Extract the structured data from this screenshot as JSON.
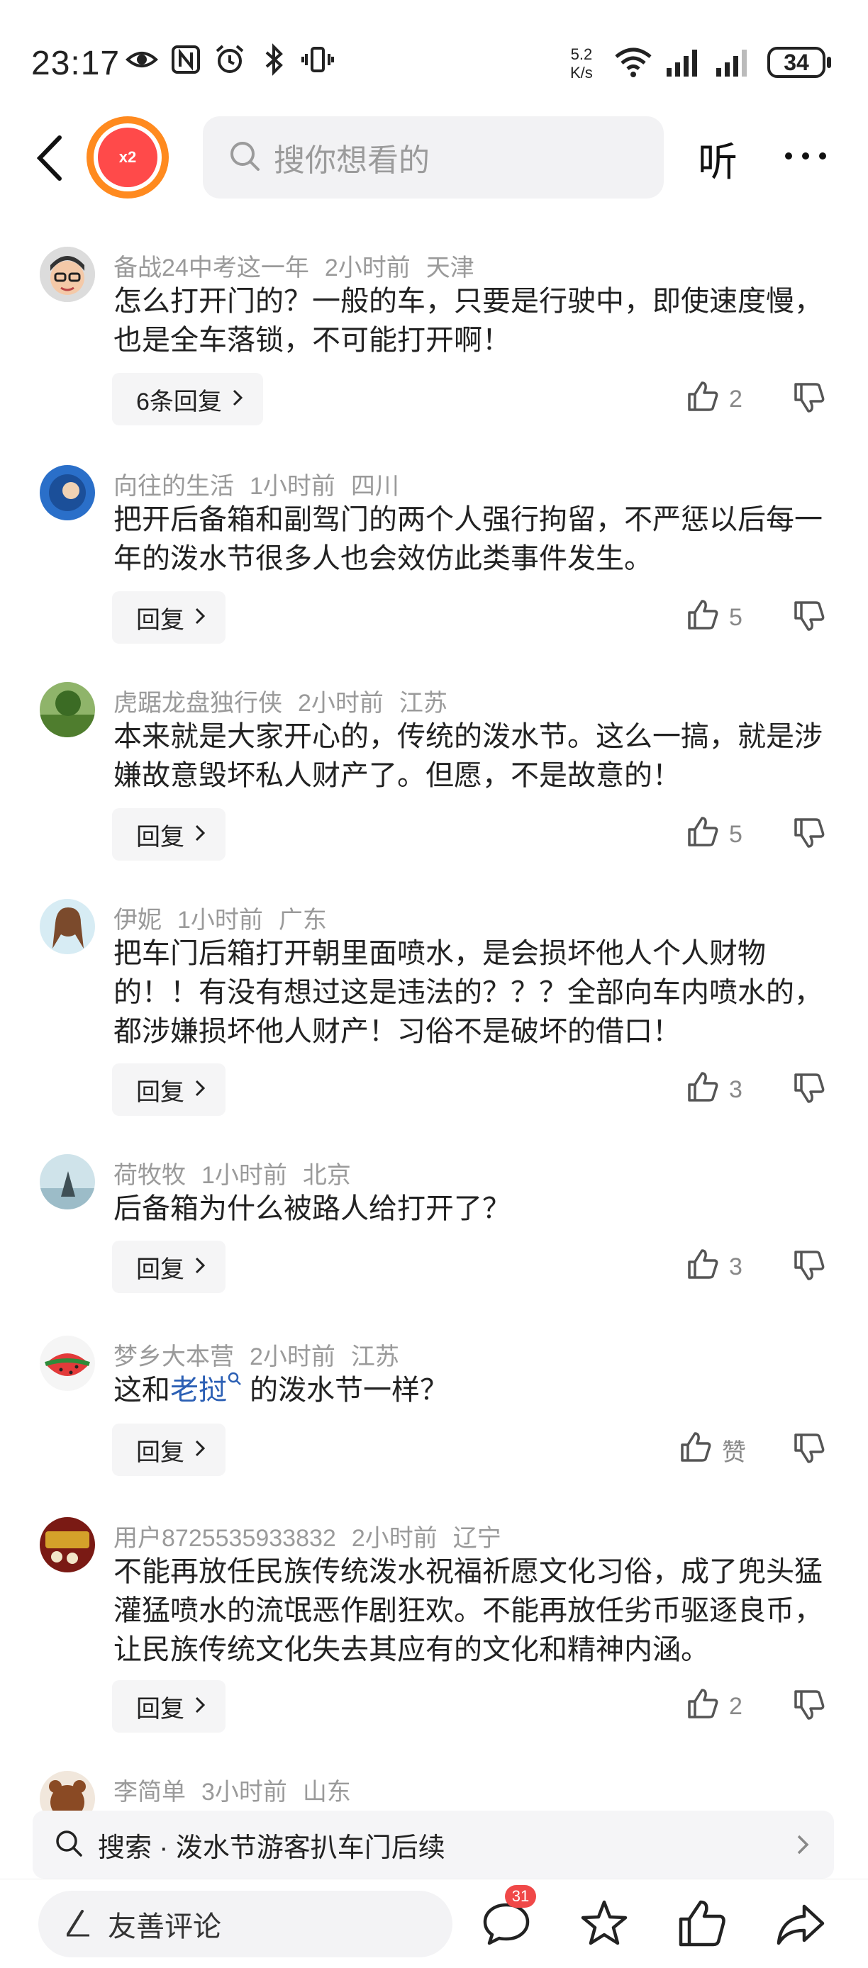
{
  "status_bar": {
    "time": "23:17",
    "net_speed_top": "5.2",
    "net_speed_unit": "K/s",
    "battery": "34"
  },
  "header": {
    "badge_text": "x2",
    "search_placeholder": "搜你想看的",
    "listen_label": "听"
  },
  "comments": [
    {
      "user": "备战24中考这一年",
      "time": "2小时前",
      "location": "天津",
      "text": "怎么打开门的？一般的车，只要是行驶中，即使速度慢，也是全车落锁，不可能打开啊！",
      "reply_label": "6条回复",
      "likes": "2"
    },
    {
      "user": "向往的生活",
      "time": "1小时前",
      "location": "四川",
      "text": "把开后备箱和副驾门的两个人强行拘留，不严惩以后每一年的泼水节很多人也会效仿此类事件发生。",
      "reply_label": "回复",
      "likes": "5"
    },
    {
      "user": "虎踞龙盘独行侠",
      "time": "2小时前",
      "location": "江苏",
      "text": "本来就是大家开心的，传统的泼水节。这么一搞，就是涉嫌故意毁坏私人财产了。但愿，不是故意的！",
      "reply_label": "回复",
      "likes": "5"
    },
    {
      "user": "伊妮",
      "time": "1小时前",
      "location": "广东",
      "text": "把车门后箱打开朝里面喷水，是会损坏他人个人财物的！！有没有想过这是违法的？？？全部向车内喷水的，都涉嫌损坏他人财产！习俗不是破坏的借口！",
      "reply_label": "回复",
      "likes": "3"
    },
    {
      "user": "荷牧牧",
      "time": "1小时前",
      "location": "北京",
      "text": "后备箱为什么被路人给打开了？",
      "reply_label": "回复",
      "likes": "3"
    },
    {
      "user": "梦乡大本营",
      "time": "2小时前",
      "location": "江苏",
      "text_before": "这和",
      "text_link": "老挝",
      "text_after": "的泼水节一样？",
      "reply_label": "回复",
      "likes": "赞"
    },
    {
      "user": "用户8725535933832",
      "time": "2小时前",
      "location": "辽宁",
      "text": "不能再放任民族传统泼水祝福祈愿文化习俗，成了兜头猛灌猛喷水的流氓恶作剧狂欢。不能再放任劣币驱逐良币，让民族传统文化失去其应有的文化和精神内涵。",
      "reply_label": "回复",
      "likes": "2"
    },
    {
      "user": "李简单",
      "time": "3小时前",
      "location": "山东"
    }
  ],
  "suggestion": {
    "text": "搜索 · 泼水节游客扒车门后续"
  },
  "bottom_bar": {
    "comment_placeholder": "友善评论",
    "comment_count": "31"
  },
  "colors": {
    "link": "#2b5fb4",
    "badge_red": "#f04848",
    "logo_orange": "#ff8a1f"
  }
}
